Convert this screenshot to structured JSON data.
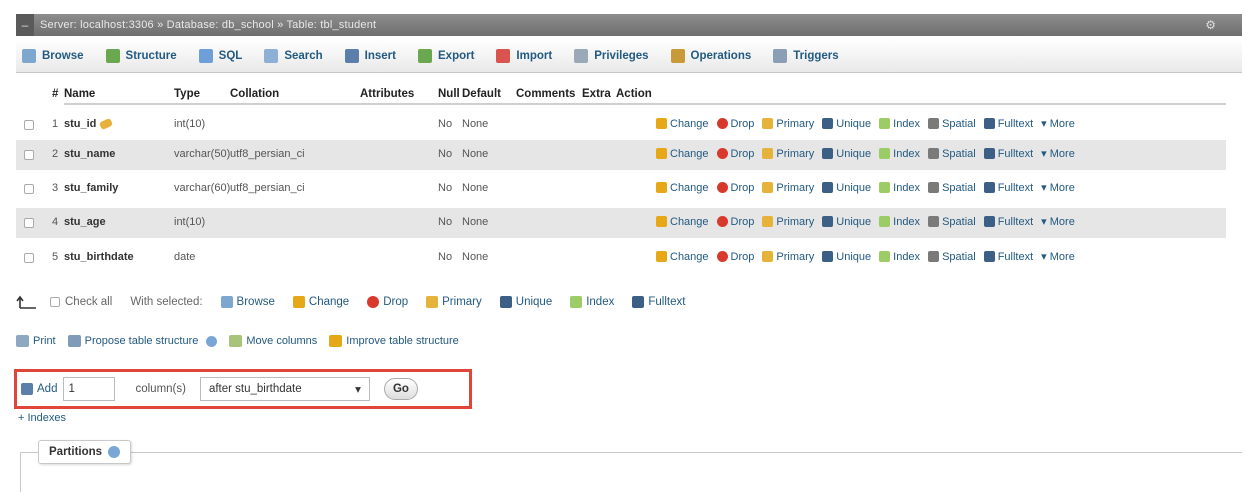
{
  "titlebar": {
    "breadcrumb": "Server: localhost:3306 » Database: db_school » Table: tbl_student",
    "gear": "⚙",
    "caret": "↕"
  },
  "tabs": [
    {
      "label": "Browse",
      "icon": "browse-icon",
      "color": "#7ea7cf"
    },
    {
      "label": "Structure",
      "icon": "structure-icon",
      "color": "#6aa84f"
    },
    {
      "label": "SQL",
      "icon": "sql-icon",
      "color": "#6f9fd8"
    },
    {
      "label": "Search",
      "icon": "search-icon",
      "color": "#8fb0d6"
    },
    {
      "label": "Insert",
      "icon": "insert-icon",
      "color": "#5b7fa8"
    },
    {
      "label": "Export",
      "icon": "export-icon",
      "color": "#6aa84f"
    },
    {
      "label": "Import",
      "icon": "import-icon",
      "color": "#d9534f"
    },
    {
      "label": "Privileges",
      "icon": "privileges-icon",
      "color": "#9aa9b8"
    },
    {
      "label": "Operations",
      "icon": "operations-icon",
      "color": "#c99a3a"
    },
    {
      "label": "Triggers",
      "icon": "triggers-icon",
      "color": "#8a9fb5"
    }
  ],
  "table": {
    "headers": {
      "num": "#",
      "name": "Name",
      "type": "Type",
      "collation": "Collation",
      "attributes": "Attributes",
      "null": "Null",
      "default": "Default",
      "comments": "Comments",
      "extra": "Extra",
      "action": "Action"
    },
    "rows": [
      {
        "num": "1",
        "name": "stu_id",
        "primary_key": true,
        "type": "int(10)",
        "collation": "",
        "null": "No",
        "default": "None"
      },
      {
        "num": "2",
        "name": "stu_name",
        "primary_key": false,
        "type": "varchar(50)",
        "collation": "utf8_persian_ci",
        "null": "No",
        "default": "None"
      },
      {
        "num": "3",
        "name": "stu_family",
        "primary_key": false,
        "type": "varchar(60)",
        "collation": "utf8_persian_ci",
        "null": "No",
        "default": "None"
      },
      {
        "num": "4",
        "name": "stu_age",
        "primary_key": false,
        "type": "int(10)",
        "collation": "",
        "null": "No",
        "default": "None"
      },
      {
        "num": "5",
        "name": "stu_birthdate",
        "primary_key": false,
        "type": "date",
        "collation": "",
        "null": "No",
        "default": "None"
      }
    ],
    "actions": [
      {
        "label": "Change",
        "icon": "pencil-icon",
        "color": "#e6a817"
      },
      {
        "label": "Drop",
        "icon": "drop-icon",
        "color": "#d9382c"
      },
      {
        "label": "Primary",
        "icon": "key-icon",
        "color": "#e6b33a"
      },
      {
        "label": "Unique",
        "icon": "unique-icon",
        "color": "#3c5f85"
      },
      {
        "label": "Index",
        "icon": "index-icon",
        "color": "#9ccc65"
      },
      {
        "label": "Spatial",
        "icon": "spatial-icon",
        "color": "#7a7a7a"
      },
      {
        "label": "Fulltext",
        "icon": "fulltext-icon",
        "color": "#3c5f85"
      },
      {
        "label": "▾ More",
        "icon": "more-icon",
        "color": "#235a81"
      }
    ]
  },
  "bulk": {
    "check_all": "Check all",
    "with_selected": "With selected:",
    "items": [
      {
        "label": "Browse",
        "icon": "browse-icon",
        "color": "#7ea7cf"
      },
      {
        "label": "Change",
        "icon": "pencil-icon",
        "color": "#e6a817"
      },
      {
        "label": "Drop",
        "icon": "drop-icon",
        "color": "#d9382c"
      },
      {
        "label": "Primary",
        "icon": "key-icon",
        "color": "#e6b33a"
      },
      {
        "label": "Unique",
        "icon": "unique-icon",
        "color": "#3c5f85"
      },
      {
        "label": "Index",
        "icon": "index-icon",
        "color": "#9ccc65"
      },
      {
        "label": "Fulltext",
        "icon": "fulltext-icon",
        "color": "#3c5f85"
      }
    ]
  },
  "tools": {
    "print": "Print",
    "propose": "Propose table structure",
    "move_columns": "Move columns",
    "improve": "Improve table structure"
  },
  "add_column": {
    "add_label": "Add",
    "count_value": "1",
    "columns_label": "column(s)",
    "position_selected": "after stu_birthdate",
    "go_label": "Go",
    "highlight_color": "#e0453a"
  },
  "indexes_link": "+ Indexes",
  "partitions_label": "Partitions"
}
